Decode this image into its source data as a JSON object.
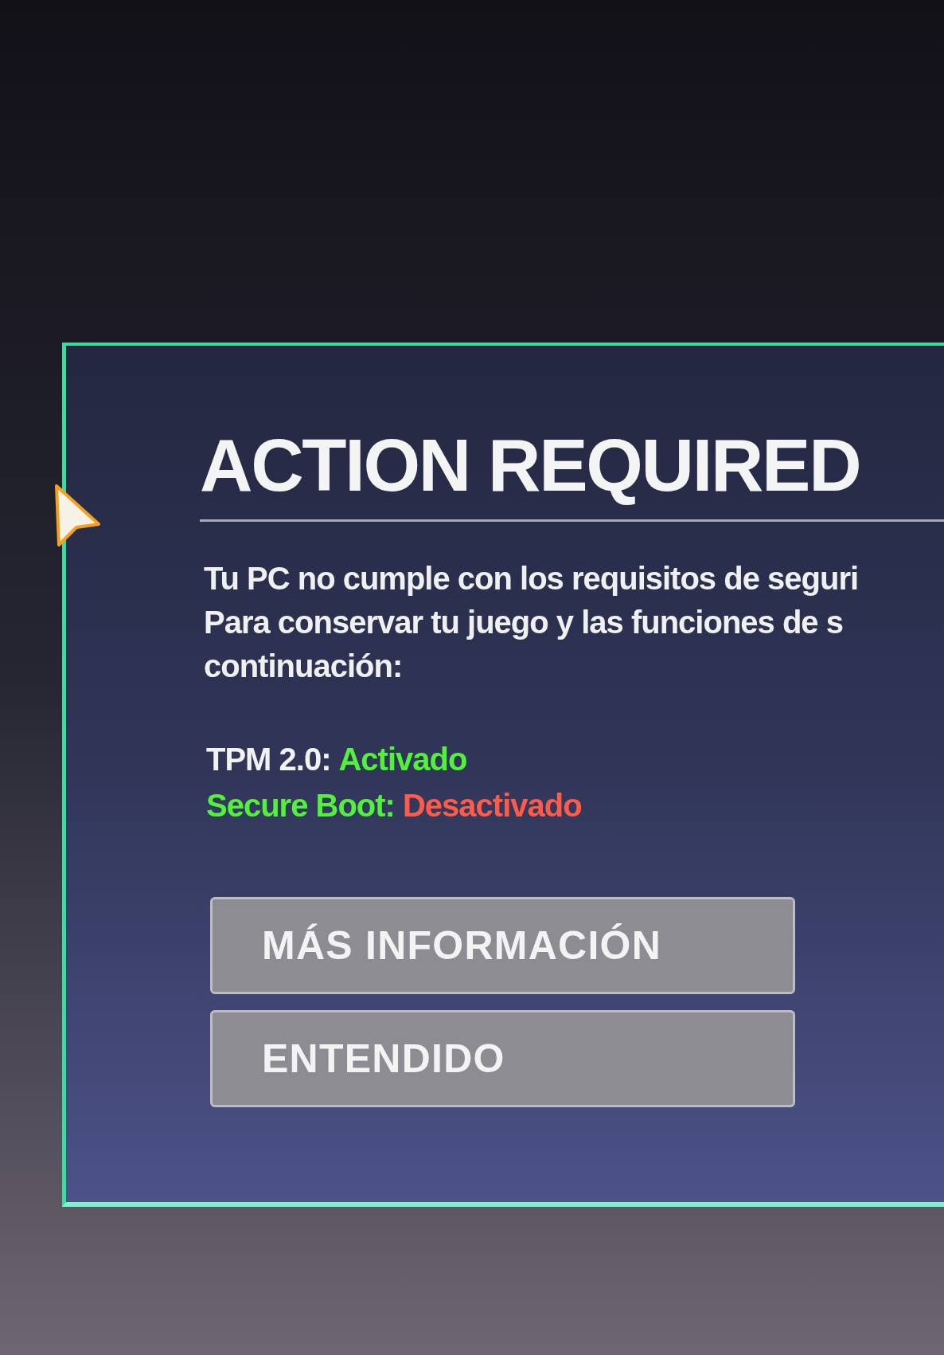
{
  "dialog": {
    "title": "ACTION REQUIRED",
    "message_lines": [
      "Tu PC no cumple con los requisitos de seguri",
      "Para conservar tu juego y las funciones de s",
      "continuación:"
    ],
    "status_rows": [
      {
        "parts": [
          {
            "text": "TPM 2.0:",
            "color": "#f2f2f2"
          },
          {
            "text": "Activado",
            "color": "#52f23c"
          }
        ]
      },
      {
        "parts": [
          {
            "text": "Secure Boot:",
            "color": "#52f23c"
          },
          {
            "text": "Desactivado",
            "color": "#ff5b48"
          }
        ]
      }
    ],
    "buttons": [
      "MÁS INFORMACIÓN",
      "ENTENDIDO"
    ]
  }
}
